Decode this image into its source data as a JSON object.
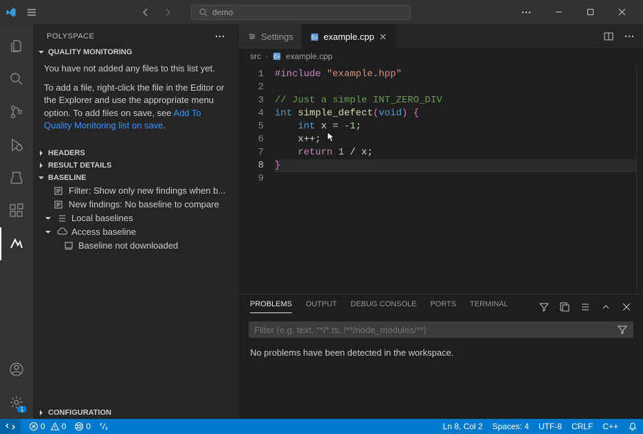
{
  "window": {
    "search_placeholder": "demo"
  },
  "activity": {
    "manage_badge": "1"
  },
  "sidebar": {
    "title": "POLYSPACE",
    "sections": {
      "quality": {
        "label": "QUALITY MONITORING",
        "empty_msg": "You have not added any files to this list yet.",
        "help1": "To add a file, right-click the file in the Editor or the Explorer and use the appropriate menu option. To add files on save, see ",
        "help_link": "Add To Quality Monitoring list on save",
        "help_suffix": "."
      },
      "headers": {
        "label": "HEADERS"
      },
      "result_details": {
        "label": "RESULT DETAILS"
      },
      "baseline": {
        "label": "BASELINE",
        "items": {
          "filter": "Filter: Show only new findings when b...",
          "new_findings": "New findings: No baseline to compare",
          "local": "Local baselines",
          "access": "Access baseline",
          "not_downloaded": "Baseline not downloaded"
        }
      },
      "configuration": {
        "label": "CONFIGURATION"
      }
    }
  },
  "tabs": {
    "settings": "Settings",
    "example": "example.cpp"
  },
  "breadcrumb": {
    "src": "src",
    "file": "example.cpp"
  },
  "code": {
    "lines": [
      {
        "n": "1",
        "pre": {
          "tok-pp": "#include "
        },
        "str": "\"example.hpp\""
      },
      {
        "n": "2"
      },
      {
        "n": "3",
        "cmt": "// Just a simple INT_ZERO_DIV"
      },
      {
        "n": "4",
        "text": "int simple_defect(void) {"
      },
      {
        "n": "5",
        "text": "    int x = -1;"
      },
      {
        "n": "6",
        "text": "    x++;"
      },
      {
        "n": "7",
        "text": "    return 1 / x;"
      },
      {
        "n": "8",
        "text": "}"
      },
      {
        "n": "9"
      }
    ]
  },
  "panel": {
    "tabs": {
      "problems": "PROBLEMS",
      "output": "OUTPUT",
      "debug_console": "DEBUG CONSOLE",
      "ports": "PORTS",
      "terminal": "TERMINAL"
    },
    "filter_placeholder": "Filter (e.g. text, **/*.ts, !**/node_modules/**)",
    "no_problems": "No problems have been detected in the workspace."
  },
  "status": {
    "errors": "0",
    "warnings": "0",
    "ports": "0",
    "cursor": "Ln 8, Col 2",
    "spaces": "Spaces: 4",
    "encoding": "UTF-8",
    "eol": "CRLF",
    "lang": "C++"
  }
}
